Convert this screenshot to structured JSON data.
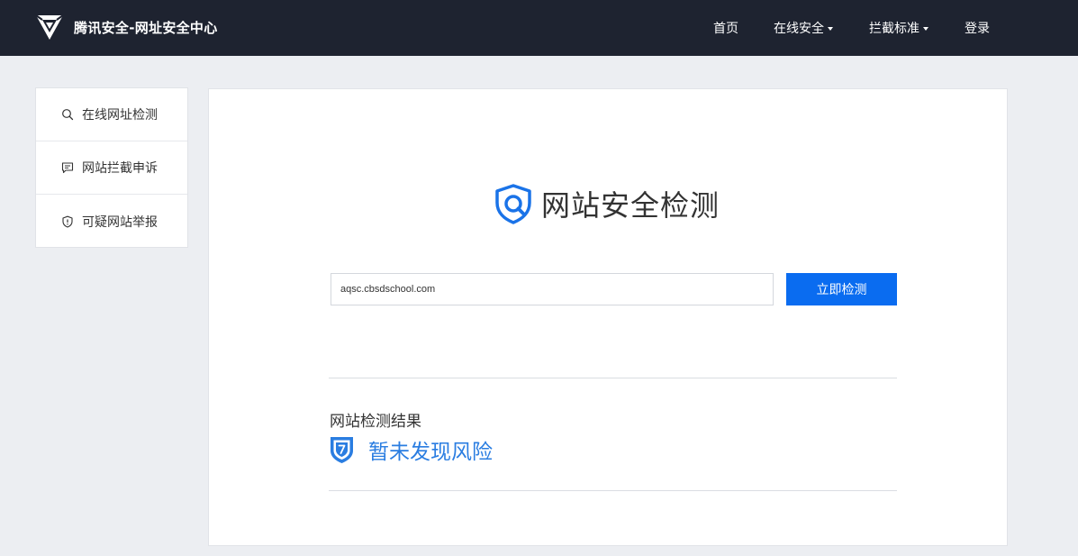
{
  "header": {
    "brand": "腾讯安全-网址安全中心",
    "nav": [
      {
        "label": "首页",
        "has_dropdown": false
      },
      {
        "label": "在线安全",
        "has_dropdown": true
      },
      {
        "label": "拦截标准",
        "has_dropdown": true
      },
      {
        "label": "登录",
        "has_dropdown": false
      }
    ]
  },
  "sidebar": {
    "items": [
      {
        "label": "在线网址检测",
        "icon": "search-icon"
      },
      {
        "label": "网站拦截申诉",
        "icon": "message-icon"
      },
      {
        "label": "可疑网站举报",
        "icon": "shield-alert-icon"
      }
    ]
  },
  "main": {
    "title": "网站安全检测",
    "url_value": "aqsc.cbsdschool.com",
    "check_button": "立即检测",
    "result_label": "网站检测结果",
    "result_text": "暂未发现风险"
  },
  "colors": {
    "topbar": "#1e2330",
    "accent": "#0a6cf0",
    "result": "#2a7de1",
    "background": "#eceef2"
  }
}
